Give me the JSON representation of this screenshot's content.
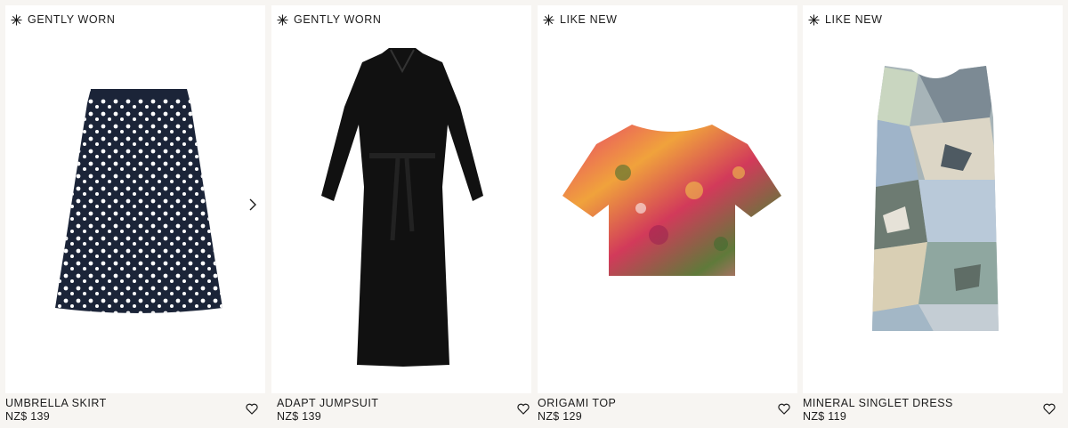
{
  "products": [
    {
      "badge": "GENTLY WORN",
      "name": "UMBRELLA SKIRT",
      "price": "NZ$ 139"
    },
    {
      "badge": "GENTLY WORN",
      "name": "ADAPT JUMPSUIT",
      "price": "NZ$ 139"
    },
    {
      "badge": "LIKE NEW",
      "name": "ORIGAMI TOP",
      "price": "NZ$ 129"
    },
    {
      "badge": "LIKE NEW",
      "name": "MINERAL SINGLET DRESS",
      "price": "NZ$ 119"
    }
  ],
  "colors": {
    "background": "#f7f5f2",
    "card": "#ffffff",
    "text": "#1c1c1c"
  },
  "icons": {
    "badge": "sparkle-icon",
    "favorite": "heart-icon",
    "next": "chevron-right-icon"
  }
}
